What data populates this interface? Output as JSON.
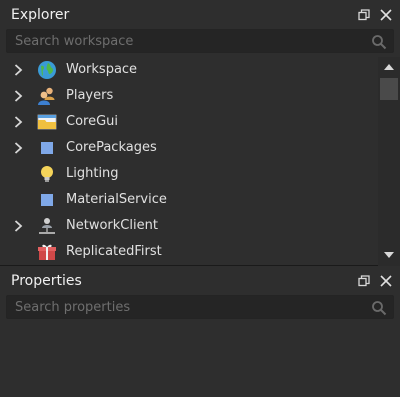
{
  "explorer": {
    "title": "Explorer",
    "search_placeholder": "Search workspace",
    "items": [
      {
        "label": "Workspace",
        "expandable": true,
        "icon": "globe-icon"
      },
      {
        "label": "Players",
        "expandable": true,
        "icon": "players-icon"
      },
      {
        "label": "CoreGui",
        "expandable": true,
        "icon": "folder-icon"
      },
      {
        "label": "CorePackages",
        "expandable": true,
        "icon": "blue-square-icon"
      },
      {
        "label": "Lighting",
        "expandable": false,
        "icon": "lightbulb-icon"
      },
      {
        "label": "MaterialService",
        "expandable": false,
        "icon": "blue-square-icon"
      },
      {
        "label": "NetworkClient",
        "expandable": true,
        "icon": "network-icon"
      },
      {
        "label": "ReplicatedFirst",
        "expandable": false,
        "icon": "gift-icon"
      }
    ]
  },
  "properties": {
    "title": "Properties",
    "search_placeholder": "Search properties"
  },
  "colors": {
    "panel_bg": "#2e2e2e",
    "search_bg": "#252525",
    "text": "#e0e0e0",
    "placeholder": "#6e6e6e"
  }
}
